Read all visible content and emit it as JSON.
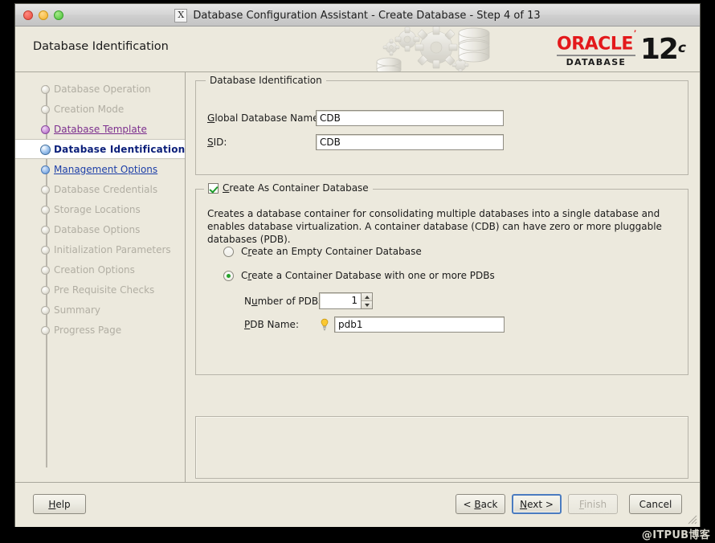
{
  "window": {
    "titlebar": {
      "app_icon": "x-window-icon",
      "title": "Database Configuration Assistant - Create Database - Step 4 of 13",
      "buttons": [
        "close",
        "minimize",
        "maximize"
      ]
    },
    "banner": {
      "page_title": "Database Identification",
      "logo": {
        "brand": "ORACLE",
        "trademark": "’",
        "product": "DATABASE",
        "version": "12",
        "edition": "c"
      }
    }
  },
  "sidebar": {
    "items": [
      {
        "label": "Database Operation",
        "state": "pending"
      },
      {
        "label": "Creation Mode",
        "state": "pending"
      },
      {
        "label": "Database Template",
        "state": "done"
      },
      {
        "label": "Database Identification",
        "state": "active"
      },
      {
        "label": "Management Options",
        "state": "link"
      },
      {
        "label": "Database Credentials",
        "state": "pending"
      },
      {
        "label": "Storage Locations",
        "state": "pending"
      },
      {
        "label": "Database Options",
        "state": "pending"
      },
      {
        "label": "Initialization Parameters",
        "state": "pending"
      },
      {
        "label": "Creation Options",
        "state": "pending"
      },
      {
        "label": "Pre Requisite Checks",
        "state": "pending"
      },
      {
        "label": "Summary",
        "state": "pending"
      },
      {
        "label": "Progress Page",
        "state": "pending"
      }
    ]
  },
  "main": {
    "identification_group": {
      "legend": "Database Identification",
      "global_db_name": {
        "label_pre": "G",
        "label_key": "l",
        "label_post": "obal Database Name:",
        "label": "Global Database Name:",
        "value": "CDB"
      },
      "sid": {
        "label_pre": "",
        "label_key": "S",
        "label_post": "ID:",
        "label": "SID:",
        "value": "CDB"
      }
    },
    "container_group": {
      "checkbox_label": "Create As Container Database",
      "checkbox_checked": "true",
      "description": "Creates a database container for consolidating multiple databases into a single database and enables database virtualization. A container database (CDB) can have zero or more pluggable databases (PDB).",
      "options": [
        {
          "label": "Create an Empty Container Database",
          "selected": "false"
        },
        {
          "label": "Create a Container Database with one or more PDBs",
          "selected": "true"
        }
      ],
      "num_pdbs": {
        "label": "Number of PDBs:",
        "value": "1"
      },
      "pdb_name": {
        "label": "PDB Name:",
        "value": "pdb1",
        "hint_icon": "lightbulb-icon"
      }
    }
  },
  "footer": {
    "help": "Help",
    "back": "< Back",
    "next": "Next >",
    "finish": "Finish",
    "cancel": "Cancel",
    "finish_disabled": "true",
    "focused": "next"
  },
  "watermark": "@ITPUB博客",
  "colors": {
    "panel_bg": "#ece9dd",
    "accent_link": "#1d3fa8",
    "accent_done": "#7c2f8e",
    "accent_active": "#0b1f7a",
    "oracle_red": "#e3191b",
    "check_green": "#1b9b28",
    "focus_blue": "#4b7cc0"
  }
}
